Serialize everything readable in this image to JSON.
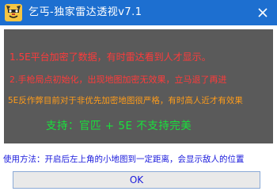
{
  "window": {
    "title": "乞丐-独家雷达透视v7.1",
    "icon": "tiger-face-icon",
    "close_icon": "close-icon"
  },
  "panel": {
    "line1": "1.5E平台加密了数据，有时雷达看到人才显示。",
    "line2": "2.手枪局点初始化，出现地图加密无效果，立马退了再进",
    "line3": "5E反作弊目前对于非优先加密地图很严格，有时高人近才有效果",
    "line4": "支持：官匹 + 5E 不支持完美"
  },
  "usage": "使用方法：开启后左上角的小地图到一定距离，会显示敌人的位置",
  "ok_button": "OK",
  "colors": {
    "titlebar": "#1d6fd0",
    "panel_bg": "#5a5a5a",
    "red_text": "#ff3b3b",
    "orange_text": "#ff9c1a",
    "green_text": "#19e23c",
    "blue_text": "#1a1adc"
  }
}
